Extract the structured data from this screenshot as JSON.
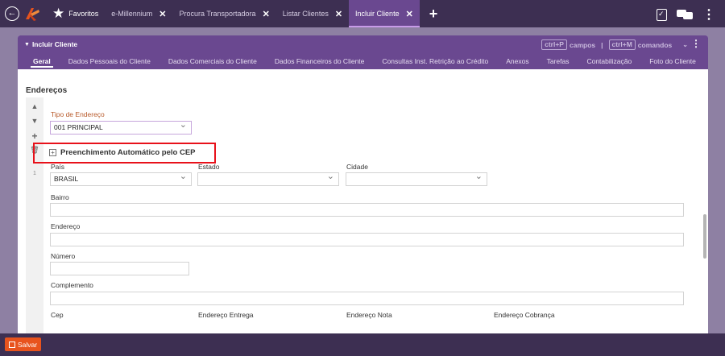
{
  "topbar": {
    "tabs": [
      {
        "label": "Favoritos",
        "close": ""
      },
      {
        "label": "e-Millennium",
        "close": "✕"
      },
      {
        "label": "Procura Transportadora",
        "close": "✕"
      },
      {
        "label": "Listar Clientes",
        "close": "✕"
      },
      {
        "label": "Incluir Cliente",
        "close": "✕"
      }
    ],
    "add_tab": "+"
  },
  "panel": {
    "title": "Incluir Cliente",
    "shortcut_campos_key": "ctrl+P",
    "shortcut_campos_label": "campos",
    "shortcut_separator": "|",
    "shortcut_comandos_key": "ctrl+M",
    "shortcut_comandos_label": "comandos",
    "subtabs": [
      "Geral",
      "Dados Pessoais do Cliente",
      "Dados Comerciais do Cliente",
      "Dados Financeiros do Cliente",
      "Consultas Inst. Retrição ao Crédito",
      "Anexos",
      "Tarefas",
      "Contabilização",
      "Foto do Cliente"
    ]
  },
  "form": {
    "section_title": "Endereços",
    "rail_index": "1",
    "tipo_endereco_label": "Tipo de Endereço",
    "tipo_endereco_value": "001 PRINCIPAL",
    "cep_auto_label": "Preenchimento Automático pelo CEP",
    "pais_label": "País",
    "pais_value": "BRASIL",
    "estado_label": "Estado",
    "estado_value": "",
    "cidade_label": "Cidade",
    "cidade_value": "",
    "bairro_label": "Bairro",
    "bairro_value": "",
    "endereco_label": "Endereço",
    "endereco_value": "",
    "numero_label": "Número",
    "numero_value": "",
    "complemento_label": "Complemento",
    "complemento_value": "",
    "cep_label": "Cep",
    "endereco_entrega_label": "Endereço Entrega",
    "endereco_nota_label": "Endereço Nota",
    "endereco_cobranca_label": "Endereço Cobrança"
  },
  "bottombar": {
    "save_label": "Salvar"
  },
  "colors": {
    "topbar_bg": "#3d2f52",
    "accent_purple": "#6a4890",
    "highlight_red": "#e8111a",
    "save_orange": "#e8531d"
  }
}
